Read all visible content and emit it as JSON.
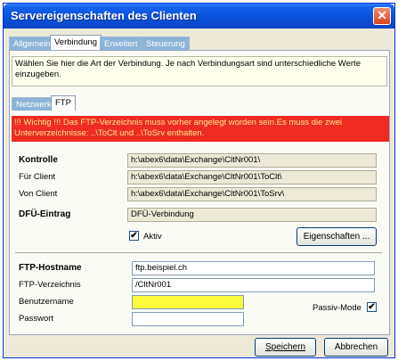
{
  "window": {
    "title": "Servereigenschaften des Clienten",
    "close_glyph": "✕"
  },
  "tabs": [
    {
      "label": "Allgemein",
      "active": false
    },
    {
      "label": "Verbindung",
      "active": true
    },
    {
      "label": "Erweitert",
      "active": false
    },
    {
      "label": "Steuerung",
      "active": false
    }
  ],
  "description": "Wählen Sie hier die Art der Verbindung. Je nach Verbindungsart sind unterschiedliche Werte einzugeben.",
  "subtabs": [
    {
      "label": "Netzwerk",
      "active": false
    },
    {
      "label": "FTP",
      "active": true
    }
  ],
  "warning": "!!! Wichtig !!! Das FTP-Verzeichnis muss vorher angelegt worden sein.Es muss die zwei Unterverzeichnisse: ..\\ToClt und ..\\ToSrv enthalten.",
  "kontrolle": {
    "heading": "Kontrolle",
    "kontrolle_path": "h:\\abex6\\data\\Exchange\\CltNr001\\",
    "fuer_client_label": "Für Client",
    "fuer_client_path": "h:\\abex6\\data\\Exchange\\CltNr001\\ToClt\\",
    "von_client_label": "Von Client",
    "von_client_path": "h:\\abex6\\data\\Exchange\\CltNr001\\ToSrv\\"
  },
  "dfue": {
    "heading": "DFÜ-Eintrag",
    "value": "DFÜ-Verbindung",
    "aktiv_label": "Aktiv",
    "aktiv_checked": true,
    "check_glyph": "✔",
    "eigenschaften_label": "Eigenschaften ..."
  },
  "ftp": {
    "hostname_label": "FTP-Hostname",
    "hostname_value": "ftp.beispiel.ch",
    "verzeichnis_label": "FTP-Verzeichnis",
    "verzeichnis_value": "/CltNr001",
    "benutzername_label": "Benutzername",
    "benutzername_value": "",
    "passwort_label": "Passwort",
    "passwort_value": "",
    "passiv_label": "Passiv-Mode",
    "passiv_checked": true,
    "accent_yellow": "#fbfb3c"
  },
  "footer": {
    "save_label": "Speichern",
    "cancel_label": "Abbrechen"
  }
}
